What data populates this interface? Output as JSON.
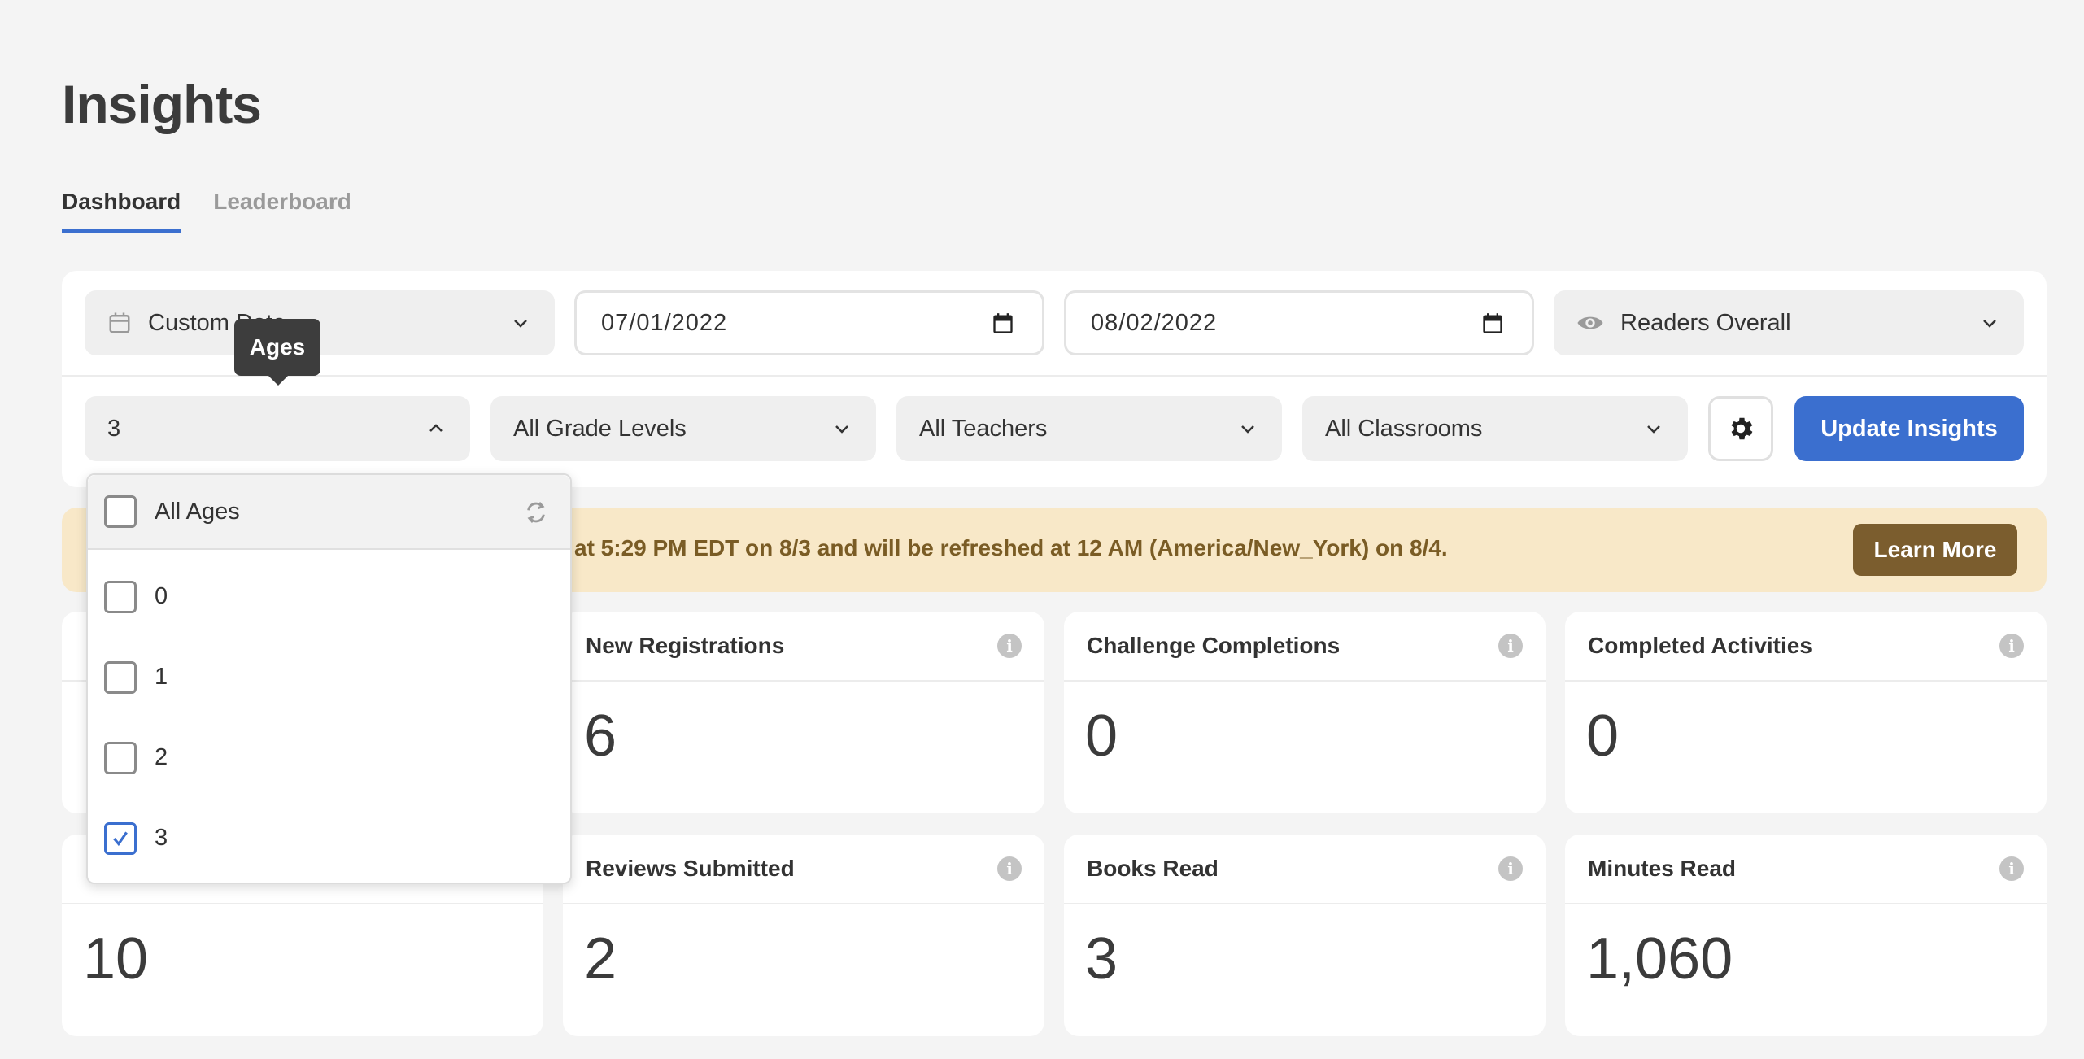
{
  "page": {
    "title": "Insights"
  },
  "tabs": [
    {
      "label": "Dashboard",
      "active": true
    },
    {
      "label": "Leaderboard",
      "active": false
    }
  ],
  "filters": {
    "date_range": {
      "value": "Custom Date",
      "icon": "calendar-icon"
    },
    "start_date": "07/01/2022",
    "end_date": "08/02/2022",
    "view": {
      "value": "Readers Overall",
      "icon": "eye-icon"
    },
    "ages": {
      "value": "3",
      "expanded": true
    },
    "grade_levels": "All Grade Levels",
    "teachers": "All Teachers",
    "classrooms": "All Classrooms",
    "settings_icon": "gear-icon",
    "update_button": "Update Insights"
  },
  "tooltip": {
    "text": "Ages"
  },
  "ages_dropdown": {
    "all_label": "All Ages",
    "all_checked": false,
    "reset_icon": "refresh-icon",
    "options": [
      {
        "label": "0",
        "checked": false
      },
      {
        "label": "1",
        "checked": false
      },
      {
        "label": "2",
        "checked": false
      },
      {
        "label": "3",
        "checked": true
      }
    ]
  },
  "banner": {
    "text": "at 5:29 PM EDT on 8/3 and will be refreshed at 12 AM (America/New_York) on 8/4.",
    "button": "Learn More"
  },
  "stats": [
    {
      "title": "New Registrations",
      "value": "6"
    },
    {
      "title": "Challenge Completions",
      "value": "0"
    },
    {
      "title": "Completed Activities",
      "value": "0"
    },
    {
      "title": "",
      "value": "10"
    },
    {
      "title": "Reviews Submitted",
      "value": "2"
    },
    {
      "title": "Books Read",
      "value": "3"
    },
    {
      "title": "Minutes Read",
      "value": "1,060"
    }
  ],
  "colors": {
    "accent": "#3b6fcf",
    "banner_bg": "#f8e8c8",
    "banner_text": "#7a5c25",
    "learn_button": "#7b5d2e"
  }
}
